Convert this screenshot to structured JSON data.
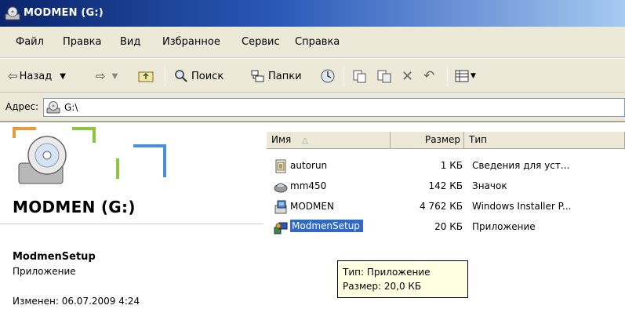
{
  "window": {
    "title": "MODMEN (G:)",
    "icon": "drive-icon"
  },
  "menu": [
    "Файл",
    "Правка",
    "Вид",
    "Избранное",
    "Сервис",
    "Справка"
  ],
  "toolbar": {
    "back": "Назад",
    "search": "Поиск",
    "folders": "Папки"
  },
  "address": {
    "label": "Адрес:",
    "value": "G:\\"
  },
  "details": {
    "drive_title": "MODMEN (G:)",
    "selected_name": "ModmenSetup",
    "selected_type": "Приложение",
    "modified": "Изменен: 06.07.2009 4:24"
  },
  "columns": {
    "name": "Имя",
    "size": "Размер",
    "type": "Тип"
  },
  "files": [
    {
      "name": "autorun",
      "size": "1 КБ",
      "type": "Сведения для уст...",
      "icon": "inf-file-icon"
    },
    {
      "name": "mm450",
      "size": "142 КБ",
      "type": "Значок",
      "icon": "ico-file-icon"
    },
    {
      "name": "MODMEN",
      "size": "4 762 КБ",
      "type": "Windows Installer P...",
      "icon": "msi-file-icon"
    },
    {
      "name": "ModmenSetup",
      "size": "20 КБ",
      "type": "Приложение",
      "icon": "exe-file-icon",
      "selected": true
    }
  ],
  "tooltip": {
    "line1": "Тип: Приложение",
    "line2": "Размер: 20,0 КБ"
  }
}
